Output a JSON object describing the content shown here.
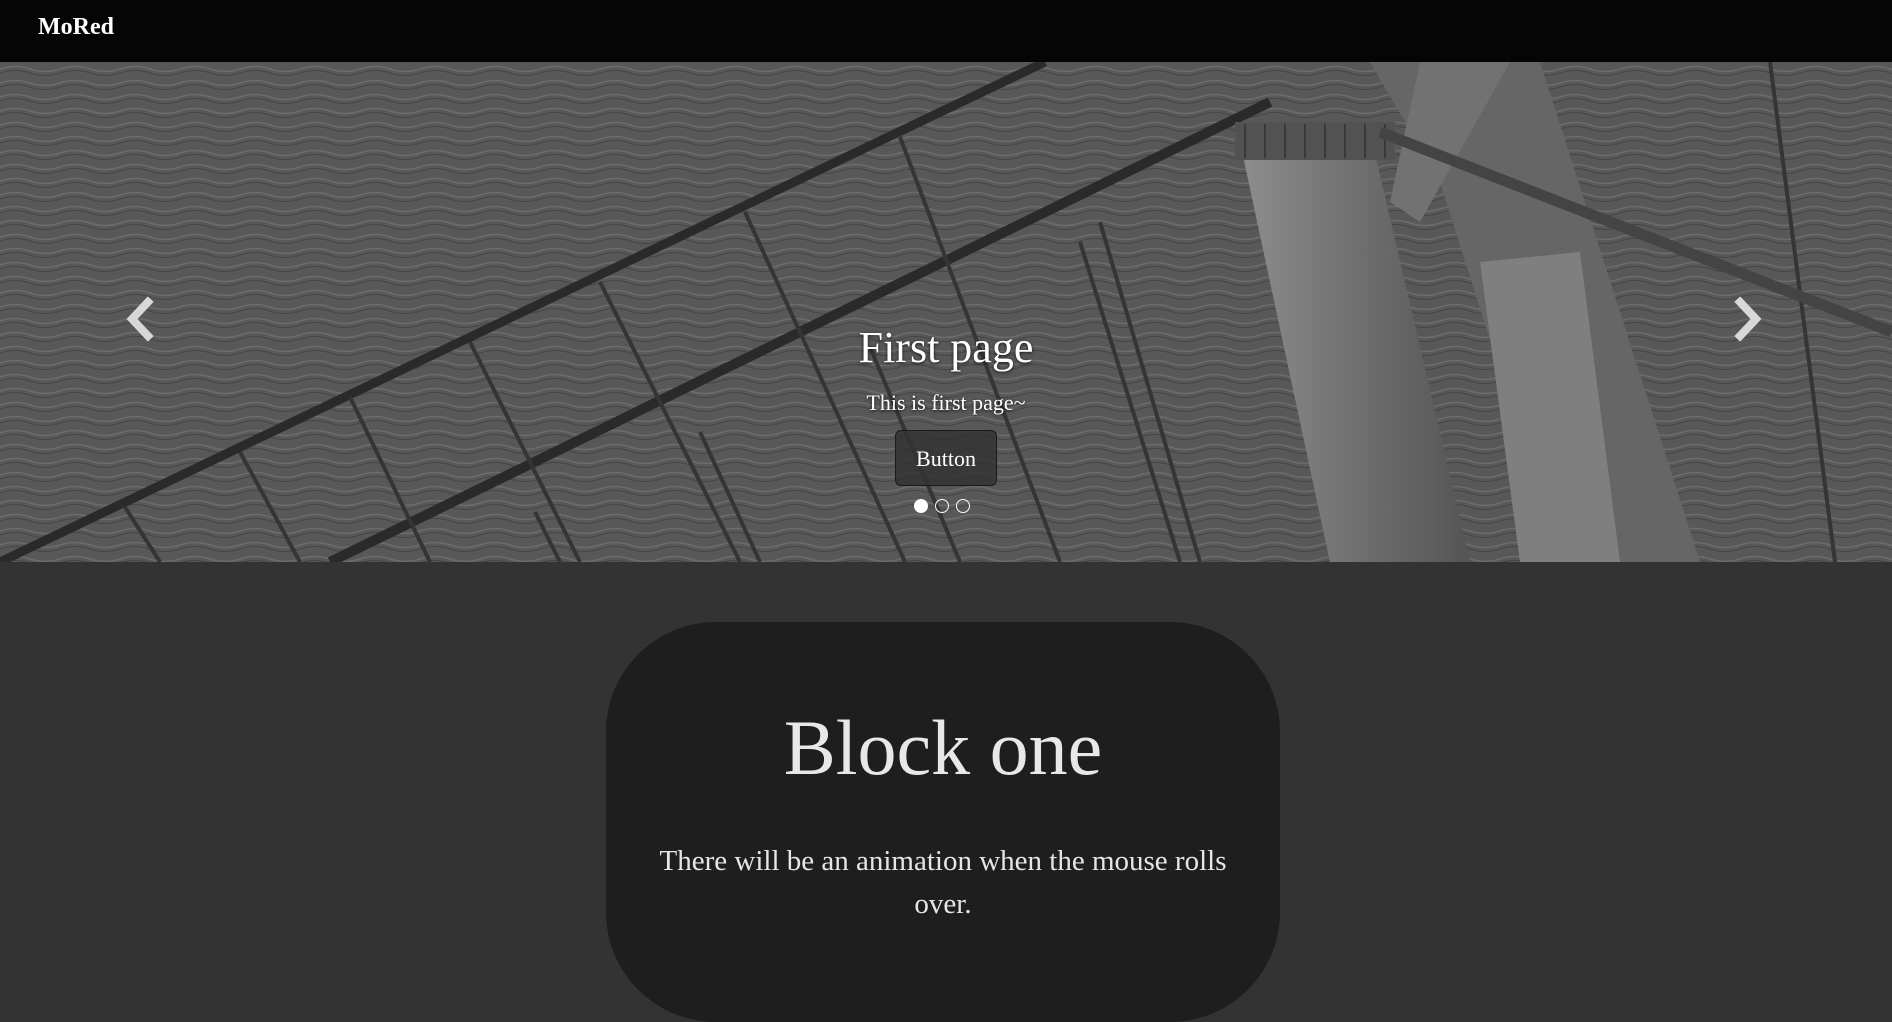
{
  "navbar": {
    "brand": "MoRed"
  },
  "carousel": {
    "slides": [
      {
        "title": "First page",
        "text": "This is first page~",
        "button_label": "Button"
      }
    ],
    "active_index": 0,
    "indicator_count": 3,
    "prev_icon": "chevron-left-icon",
    "next_icon": "chevron-right-icon"
  },
  "block": {
    "title": "Block one",
    "text": "There will be an animation when the mouse rolls over."
  },
  "colors": {
    "navbar_bg": "#050505",
    "page_bg": "#333333",
    "block_bg": "#1e1e1e",
    "text": "#ffffff"
  }
}
